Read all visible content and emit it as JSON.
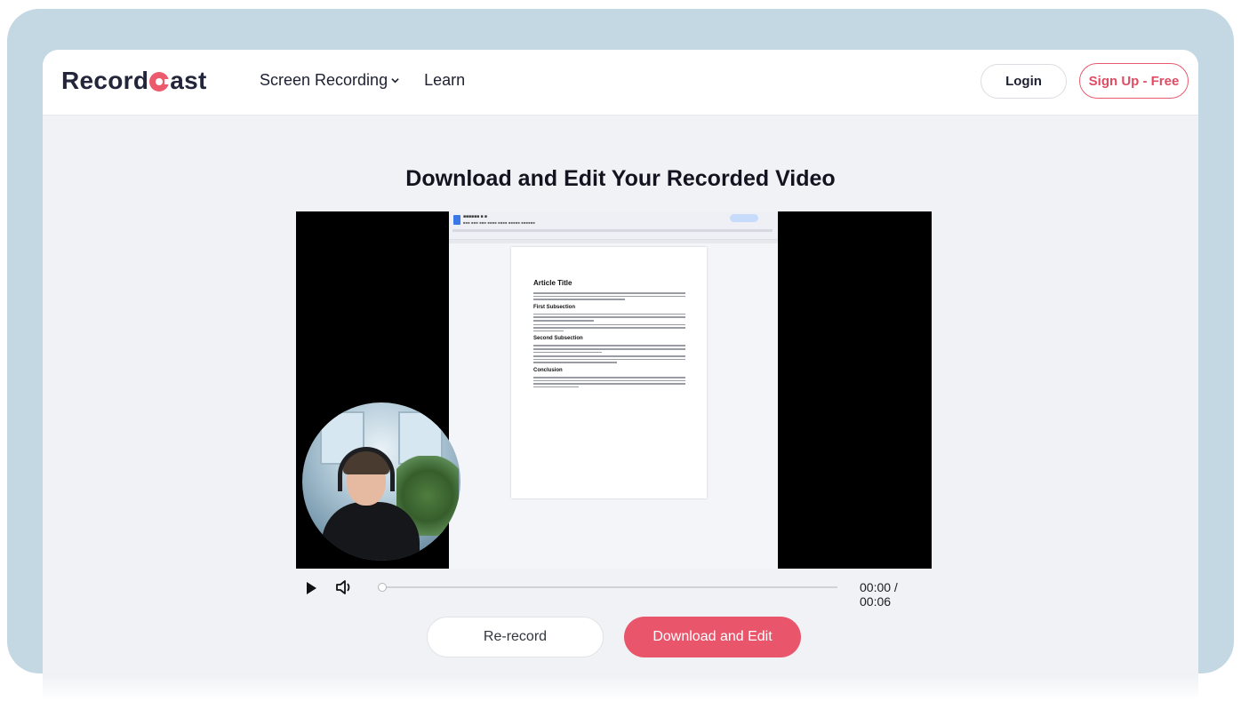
{
  "brand": {
    "logo_pre": "Record",
    "logo_post": "ast"
  },
  "nav": {
    "screen_recording": "Screen Recording",
    "learn": "Learn"
  },
  "auth": {
    "login": "Login",
    "signup": "Sign Up - Free"
  },
  "main": {
    "title": "Download and Edit Your Recorded Video"
  },
  "document": {
    "title": "Article Title",
    "sections": [
      "First Subsection",
      "Second Subsection",
      "Conclusion"
    ]
  },
  "player": {
    "time": "00:00 / 00:06",
    "progress": 0
  },
  "actions": {
    "rerecord": "Re-record",
    "download": "Download and Edit"
  },
  "colors": {
    "accent": "#e9566b",
    "frame": "#c3d8e3",
    "text": "#121420"
  },
  "icons": [
    "chevron-down-icon",
    "play-icon",
    "volume-icon"
  ]
}
